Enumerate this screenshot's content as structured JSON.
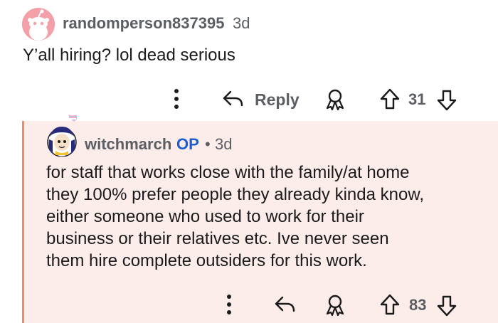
{
  "comment": {
    "username": "randomperson837395",
    "age": "3d",
    "body": "Y’all hiring? lol dead serious",
    "reply_label": "Reply",
    "score": "31"
  },
  "reply": {
    "username": "witchmarch",
    "op_label": "OP",
    "separator": "•",
    "age": "3d",
    "body_lines": [
      "for staff that works close with the family/at home",
      "they 100% prefer people they already kinda know,",
      "either someone who used to work for their",
      "business or their relatives etc. Ive never seen",
      "them hire complete outsiders for this work."
    ],
    "score": "83"
  },
  "colors": {
    "thread_line": "#f08d67",
    "reply_bg": "#fcecea",
    "op_blue": "#1a5fd1",
    "meta_gray": "#5b5f63"
  }
}
